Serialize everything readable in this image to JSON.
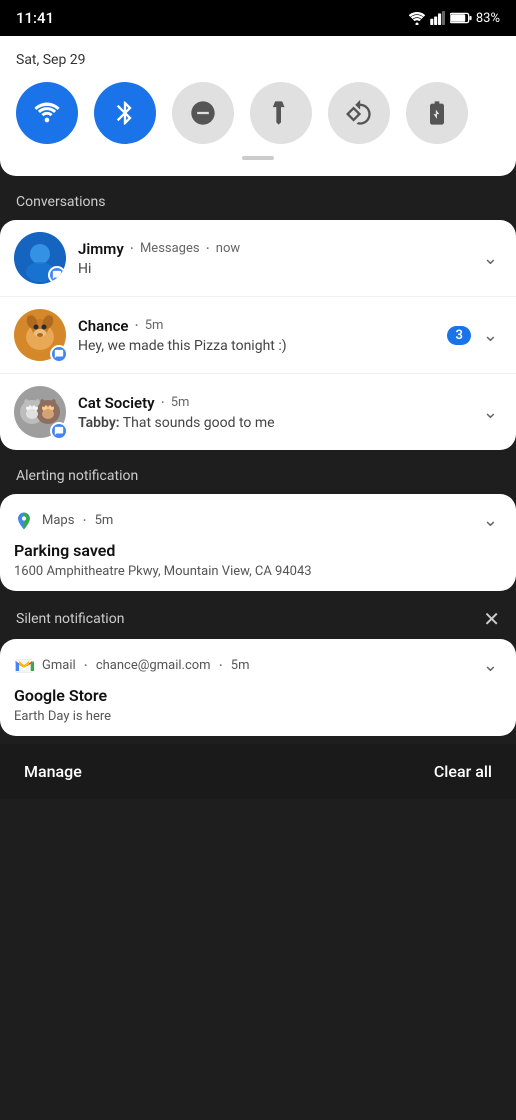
{
  "statusBar": {
    "time": "11:41",
    "battery": "83%",
    "batteryIcon": "battery-icon",
    "wifiIcon": "wifi-icon",
    "signalIcon": "signal-icon"
  },
  "quickSettings": {
    "date": "Sat, Sep 29",
    "tiles": [
      {
        "id": "wifi",
        "label": "Wi-Fi",
        "active": true
      },
      {
        "id": "bluetooth",
        "label": "Bluetooth",
        "active": true
      },
      {
        "id": "dnd",
        "label": "Do Not Disturb",
        "active": false
      },
      {
        "id": "flashlight",
        "label": "Flashlight",
        "active": false
      },
      {
        "id": "rotate",
        "label": "Auto Rotate",
        "active": false
      },
      {
        "id": "battery-saver",
        "label": "Battery Saver",
        "active": false
      }
    ]
  },
  "sections": {
    "conversations": {
      "label": "Conversations",
      "items": [
        {
          "id": "jimmy",
          "name": "Jimmy",
          "app": "Messages",
          "time": "now",
          "message": "Hi",
          "badge": null
        },
        {
          "id": "chance",
          "name": "Chance",
          "app": null,
          "time": "5m",
          "message": "Hey, we made this Pizza tonight :)",
          "badge": "3"
        },
        {
          "id": "cat-society",
          "name": "Cat Society",
          "app": null,
          "time": "5m",
          "messagePrefix": "Tabby:",
          "message": " That sounds good to me",
          "badge": null
        }
      ]
    },
    "alerting": {
      "label": "Alerting notification",
      "app": "Maps",
      "time": "5m",
      "title": "Parking saved",
      "body": "1600 Amphitheatre Pkwy, Mountain View, CA 94043"
    },
    "silent": {
      "label": "Silent notification",
      "app": "Gmail",
      "email": "chance@gmail.com",
      "time": "5m",
      "title": "Google Store",
      "body": "Earth Day is here"
    }
  },
  "bottomBar": {
    "manageLabel": "Manage",
    "clearAllLabel": "Clear all"
  }
}
